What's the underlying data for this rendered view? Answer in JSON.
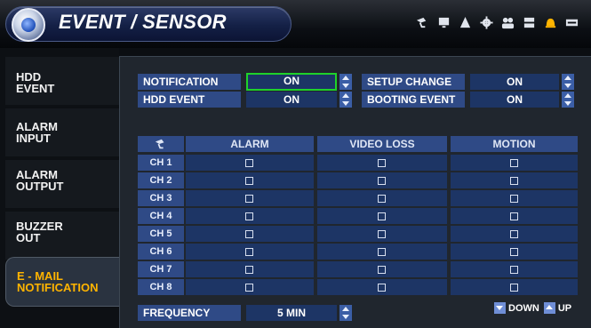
{
  "header": {
    "title": "EVENT / SENSOR",
    "icons": [
      "camera-icon",
      "monitor-icon",
      "alarm-cone-icon",
      "gear-icon",
      "users-icon",
      "storage-icon",
      "bell-icon",
      "network-icon"
    ],
    "accent_color": "#ffb400",
    "active_icon": "bell-icon"
  },
  "sidebar": {
    "items": [
      {
        "label": "HDD\nEVENT"
      },
      {
        "label": "ALARM\nINPUT"
      },
      {
        "label": "ALARM\nOUTPUT"
      },
      {
        "label": "BUZZER\nOUT"
      },
      {
        "label": "E - MAIL\nNOTIFICATION",
        "active": true
      }
    ]
  },
  "settings": {
    "notification": {
      "label": "NOTIFICATION",
      "value": "ON"
    },
    "setup_change": {
      "label": "SETUP CHANGE",
      "value": "ON"
    },
    "hdd_event": {
      "label": "HDD EVENT",
      "value": "ON"
    },
    "booting_event": {
      "label": "BOOTING EVENT",
      "value": "ON"
    }
  },
  "table": {
    "header_icon": "camera-icon",
    "columns": [
      "ALARM",
      "VIDEO LOSS",
      "MOTION"
    ],
    "rows": [
      "CH 1",
      "CH 2",
      "CH 3",
      "CH 4",
      "CH 5",
      "CH 6",
      "CH 7",
      "CH 8"
    ]
  },
  "frequency": {
    "label": "FREQUENCY",
    "value": "5 MIN"
  },
  "legend": {
    "down": "DOWN",
    "up": "UP"
  }
}
